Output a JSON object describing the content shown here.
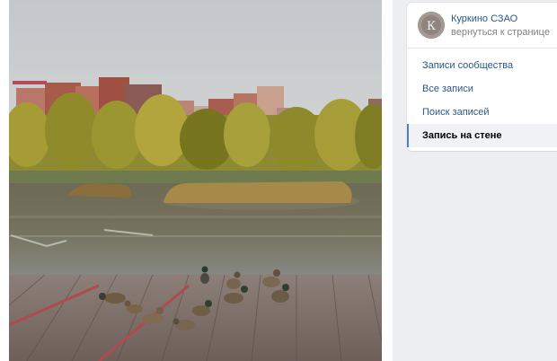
{
  "community": {
    "name": "Куркино СЗАО",
    "back_link": "вернуться к странице"
  },
  "menu": {
    "items": [
      {
        "label": "Записи сообщества",
        "active": false
      },
      {
        "label": "Все записи",
        "active": false
      },
      {
        "label": "Поиск записей",
        "active": false
      },
      {
        "label": "Запись на стене",
        "active": true
      }
    ]
  },
  "colors": {
    "link": "#2a5885",
    "muted": "#828282",
    "accent": "#5181b8",
    "page_bg": "#edeef0"
  }
}
